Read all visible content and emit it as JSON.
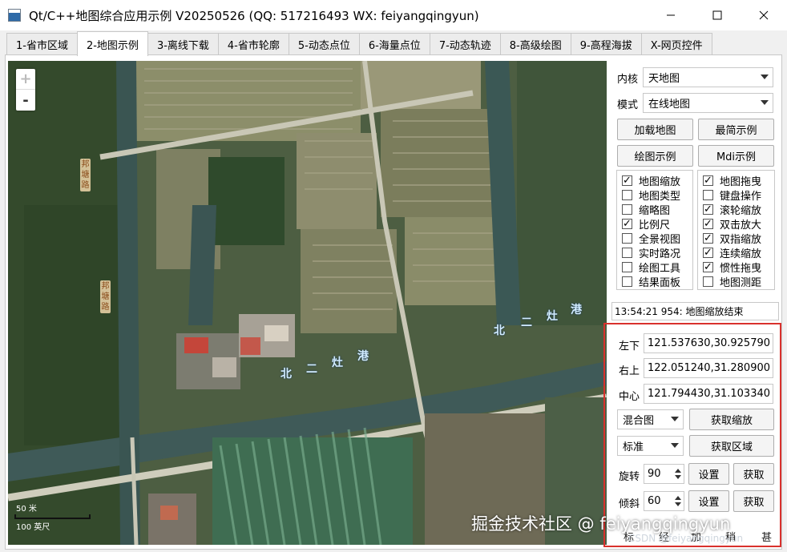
{
  "window": {
    "title": "Qt/C++地图综合应用示例 V20250526 (QQ: 517216493 WX: feiyangqingyun)"
  },
  "tabs": [
    {
      "label": "1-省市区域"
    },
    {
      "label": "2-地图示例"
    },
    {
      "label": "3-离线下载"
    },
    {
      "label": "4-省市轮廓"
    },
    {
      "label": "5-动态点位"
    },
    {
      "label": "6-海量点位"
    },
    {
      "label": "7-动态轨迹"
    },
    {
      "label": "8-高级绘图"
    },
    {
      "label": "9-高程海拔"
    },
    {
      "label": "X-网页控件"
    }
  ],
  "map": {
    "zoom_in": "+",
    "zoom_out": "-",
    "scale_top": "50 米",
    "scale_bottom": "100 英尺",
    "road_labels": [
      "北",
      "二",
      "灶",
      "港"
    ],
    "road_labels_2": [
      "北",
      "二",
      "灶",
      "港"
    ],
    "vertical_road": "邦塘路",
    "vertical_road_2": "邦塘路"
  },
  "panel": {
    "kernel_label": "内核",
    "kernel_value": "天地图",
    "mode_label": "模式",
    "mode_value": "在线地图",
    "btn_load_map": "加载地图",
    "btn_simple_demo": "最简示例",
    "btn_draw_demo": "绘图示例",
    "btn_mdi_demo": "Mdi示例",
    "checkboxes_left": [
      {
        "label": "地图缩放",
        "checked": true
      },
      {
        "label": "地图类型",
        "checked": false
      },
      {
        "label": "缩略图",
        "checked": false
      },
      {
        "label": "比例尺",
        "checked": true
      },
      {
        "label": "全景视图",
        "checked": false
      },
      {
        "label": "实时路况",
        "checked": false
      },
      {
        "label": "绘图工具",
        "checked": false
      },
      {
        "label": "结果面板",
        "checked": false
      }
    ],
    "checkboxes_right": [
      {
        "label": "地图拖曳",
        "checked": true
      },
      {
        "label": "键盘操作",
        "checked": false
      },
      {
        "label": "滚轮缩放",
        "checked": true
      },
      {
        "label": "双击放大",
        "checked": true
      },
      {
        "label": "双指缩放",
        "checked": true
      },
      {
        "label": "连续缩放",
        "checked": true
      },
      {
        "label": "惯性拖曳",
        "checked": true
      },
      {
        "label": "地图测距",
        "checked": false
      }
    ],
    "status": "13:54:21 954: 地图缩放结束",
    "bottom_left_label": "左下",
    "bottom_left_value": "121.537630,30.925790",
    "top_right_label": "右上",
    "top_right_value": "122.051240,31.280900",
    "center_label": "中心",
    "center_value": "121.794430,31.103340",
    "map_type_value": "混合图",
    "btn_get_zoom": "获取缩放",
    "style_value": "标准",
    "btn_get_region": "获取区域",
    "rotate_label": "旋转",
    "rotate_value": "90",
    "btn_set_1": "设置",
    "btn_get_1": "获取",
    "tilt_label": "倾斜",
    "tilt_value": "60",
    "btn_set_2": "设置",
    "btn_get_2": "获取",
    "cut_texts": [
      "标",
      "经",
      "加",
      "稍",
      "甚"
    ]
  },
  "watermark": {
    "main": "掘金技术社区 @ feiyangqingyun",
    "sub": "CSDN @feiyangqingyun"
  }
}
